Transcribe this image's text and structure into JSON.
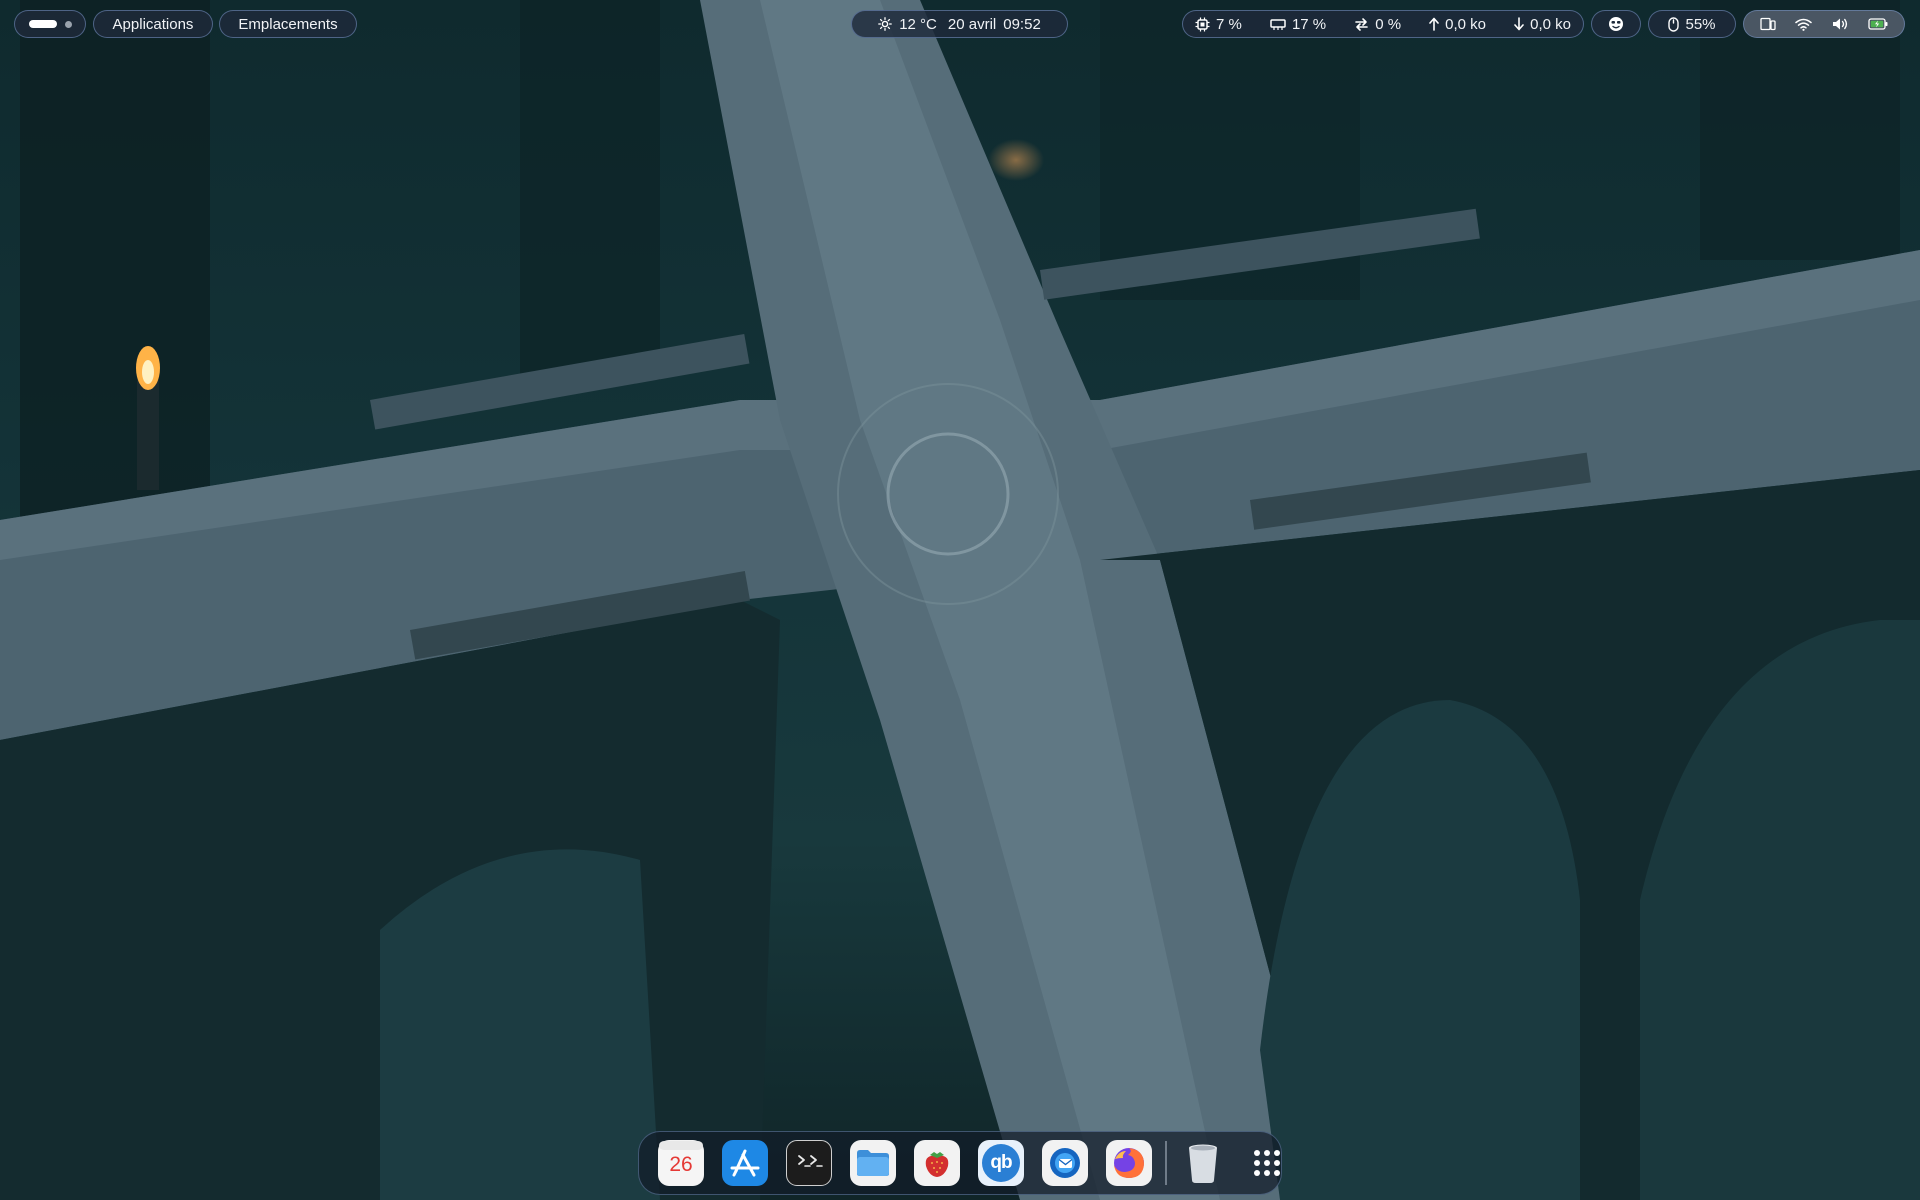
{
  "topbar": {
    "activities": {
      "icon": "activities-indicator"
    },
    "menus": [
      {
        "label": "Applications"
      },
      {
        "label": "Emplacements"
      }
    ],
    "clock": {
      "weather_icon": "sun-icon",
      "temperature": "12 °C",
      "date": "20 avril",
      "time": "09:52"
    },
    "system_monitor": {
      "cpu": {
        "icon": "cpu-icon",
        "value": "7 %"
      },
      "memory": {
        "icon": "memory-icon",
        "value": "17 %"
      },
      "swap": {
        "icon": "swap-icon",
        "value": "0 %"
      },
      "upload": {
        "icon": "upload-arrow-icon",
        "value": "0,0 ko"
      },
      "download": {
        "icon": "download-arrow-icon",
        "value": "0,0 ko"
      }
    },
    "emoji": {
      "icon": "emoji-face-icon"
    },
    "mouse_battery": {
      "icon": "mouse-icon",
      "value": "55%"
    },
    "quick_settings": {
      "icons": [
        "screen-icon",
        "wifi-icon",
        "volume-icon",
        "battery-charging-icon"
      ]
    }
  },
  "dock": {
    "items": [
      {
        "name": "calendar",
        "icon": "calendar-icon",
        "label": "26",
        "color": "#e53935"
      },
      {
        "name": "software-center",
        "icon": "app-store-icon",
        "color": "#1e88e5"
      },
      {
        "name": "terminal",
        "icon": "terminal-icon",
        "color": "#222222"
      },
      {
        "name": "files",
        "icon": "folder-icon",
        "color": "#4aa3e8"
      },
      {
        "name": "strawberry",
        "icon": "strawberry-icon",
        "color": "#d32f2f"
      },
      {
        "name": "qbittorrent",
        "icon": "qbittorrent-icon",
        "label": "qb",
        "color": "#2a7fd4"
      },
      {
        "name": "thunderbird",
        "icon": "thunderbird-icon",
        "color": "#1565c0"
      },
      {
        "name": "firefox",
        "icon": "firefox-icon",
        "color": "#ff7139"
      },
      {
        "name": "trash",
        "icon": "trash-icon",
        "color": "#dfe3e8"
      },
      {
        "name": "show-apps",
        "icon": "app-grid-icon",
        "color": "#ffffff"
      }
    ]
  }
}
